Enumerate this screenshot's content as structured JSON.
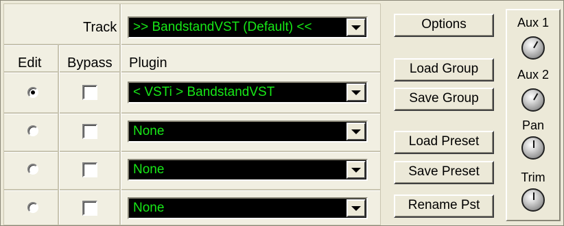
{
  "track": {
    "label": "Track",
    "value": ">> BandstandVST (Default) <<"
  },
  "columns": {
    "edit": "Edit",
    "bypass": "Bypass",
    "plugin": "Plugin"
  },
  "rows": [
    {
      "edit_selected": true,
      "bypass": false,
      "plugin": "< VSTi > BandstandVST"
    },
    {
      "edit_selected": false,
      "bypass": false,
      "plugin": "None"
    },
    {
      "edit_selected": false,
      "bypass": false,
      "plugin": "None"
    },
    {
      "edit_selected": false,
      "bypass": false,
      "plugin": "None"
    }
  ],
  "buttons": {
    "options": "Options",
    "load_group": "Load Group",
    "save_group": "Save Group",
    "load_preset": "Load Preset",
    "save_preset": "Save Preset",
    "rename_preset": "Rename Pst"
  },
  "knobs": [
    {
      "label": "Aux 1",
      "icon": "knob-icon"
    },
    {
      "label": "Aux 2",
      "icon": "knob-icon"
    },
    {
      "label": "Pan",
      "icon": "knob-icon"
    },
    {
      "label": "Trim",
      "icon": "knob-icon"
    }
  ],
  "colors": {
    "display_bg": "#000000",
    "display_text": "#17e817",
    "panel": "#ece9d8"
  }
}
